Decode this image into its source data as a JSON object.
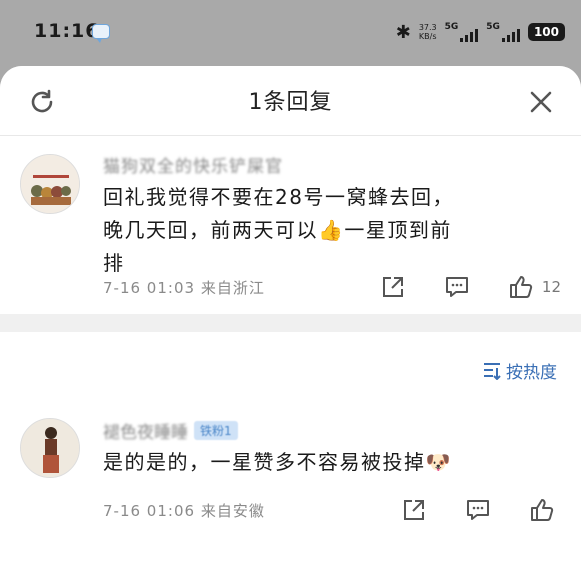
{
  "status_bar": {
    "time": "11:16",
    "speed_value": "37.3",
    "speed_unit": "KB/s",
    "network_1": "5G",
    "network_2": "5G",
    "battery": "100"
  },
  "header": {
    "title": "1条回复"
  },
  "main_comment": {
    "username": "猫狗双全的快乐铲屎官",
    "text_part1": "回礼我觉得不要在28号一窝蜂去回，晚几天回，前两天可以",
    "emoji": "👍",
    "text_part2": "一星顶到前排",
    "time": "7-16 01:03",
    "location": "来自浙江",
    "like_count": "12"
  },
  "sort": {
    "label": "按热度"
  },
  "reply": {
    "username": "褪色夜睡睡",
    "fan_badge": "铁粉1",
    "text": "是的是的，一星赞多不容易被投掉",
    "emoji": "🐶",
    "time": "7-16 01:06",
    "location": "来自安徽"
  },
  "colors": {
    "accent": "#3a6fb5",
    "background_dim": "#a9a9a9"
  }
}
